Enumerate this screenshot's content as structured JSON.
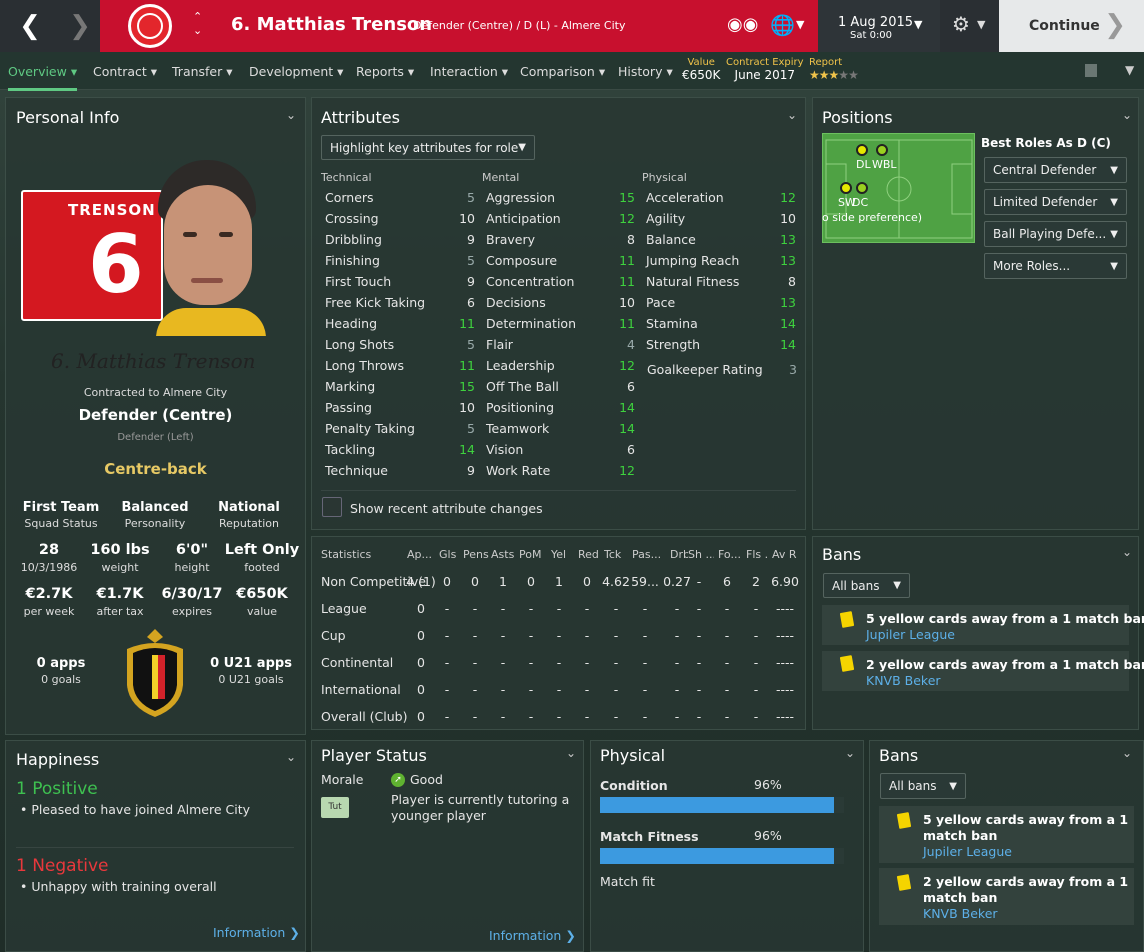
{
  "header": {
    "player_title": "6. Matthias Trenson",
    "player_sub": "Defender (Centre) / D (L) - Almere City",
    "date": "1 Aug 2015",
    "day": "Sat 0:00",
    "continue": "Continue",
    "club": "ALMERE CITY"
  },
  "nav": {
    "items": [
      "Overview",
      "Contract",
      "Transfer",
      "Development",
      "Reports",
      "Interaction",
      "Comparison",
      "History"
    ],
    "value_label": "Value",
    "value": "€650K",
    "expiry_label": "Contract Expiry",
    "expiry": "June 2017",
    "report_label": "Report",
    "report_stars": 3,
    "report_max": 5
  },
  "personal": {
    "title": "Personal Info",
    "shirt_name": "TRENSON",
    "shirt_number": "6",
    "signature": "6. Matthias Trenson",
    "contracted": "Contracted to Almere City",
    "position": "Defender (Centre)",
    "position2": "Defender (Left)",
    "role": "Centre-back",
    "stats": [
      [
        "First Team",
        "Squad Status"
      ],
      [
        "Balanced",
        "Personality"
      ],
      [
        "National",
        "Reputation"
      ],
      [
        "28",
        "10/3/1986"
      ],
      [
        "160 lbs",
        "weight"
      ],
      [
        "6'0\"",
        "height"
      ],
      [
        "Left Only",
        "footed"
      ],
      [
        "€2.7K",
        "per week"
      ],
      [
        "€1.7K",
        "after tax"
      ],
      [
        "6/30/17",
        "expires"
      ],
      [
        "€650K",
        "value"
      ],
      [
        "0 apps",
        "0 goals"
      ],
      [
        "0 U21 apps",
        "0 U21 goals"
      ]
    ]
  },
  "attributes": {
    "title": "Attributes",
    "highlight": "Highlight key attributes for role",
    "show_changes": "Show recent attribute changes",
    "technical_label": "Technical",
    "mental_label": "Mental",
    "physical_label": "Physical",
    "technical": [
      [
        "Corners",
        "5"
      ],
      [
        "Crossing",
        "10"
      ],
      [
        "Dribbling",
        "9"
      ],
      [
        "Finishing",
        "5"
      ],
      [
        "First Touch",
        "9"
      ],
      [
        "Free Kick Taking",
        "6"
      ],
      [
        "Heading",
        "11"
      ],
      [
        "Long Shots",
        "5"
      ],
      [
        "Long Throws",
        "11"
      ],
      [
        "Marking",
        "15"
      ],
      [
        "Passing",
        "10"
      ],
      [
        "Penalty Taking",
        "5"
      ],
      [
        "Tackling",
        "14"
      ],
      [
        "Technique",
        "9"
      ]
    ],
    "mental": [
      [
        "Aggression",
        "15"
      ],
      [
        "Anticipation",
        "12"
      ],
      [
        "Bravery",
        "8"
      ],
      [
        "Composure",
        "11"
      ],
      [
        "Concentration",
        "11"
      ],
      [
        "Decisions",
        "10"
      ],
      [
        "Determination",
        "11"
      ],
      [
        "Flair",
        "4"
      ],
      [
        "Leadership",
        "12"
      ],
      [
        "Off The Ball",
        "6"
      ],
      [
        "Positioning",
        "14"
      ],
      [
        "Teamwork",
        "14"
      ],
      [
        "Vision",
        "6"
      ],
      [
        "Work Rate",
        "12"
      ]
    ],
    "physical": [
      [
        "Acceleration",
        "12"
      ],
      [
        "Agility",
        "10"
      ],
      [
        "Balance",
        "13"
      ],
      [
        "Jumping Reach",
        "13"
      ],
      [
        "Natural Fitness",
        "8"
      ],
      [
        "Pace",
        "13"
      ],
      [
        "Stamina",
        "14"
      ],
      [
        "Strength",
        "14"
      ]
    ],
    "gk_label": "Goalkeeper Rating",
    "gk_value": "3"
  },
  "positions": {
    "title": "Positions",
    "best_roles": "Best Roles As D (C)",
    "labels": [
      "DL",
      "WBL",
      "SW",
      "DC"
    ],
    "pref_note": "o side preference)",
    "roles": [
      "Central Defender",
      "Limited Defender",
      "Ball Playing Defe...",
      "More Roles..."
    ]
  },
  "statistics": {
    "headers": [
      "Statistics",
      "Ap...",
      "Gls",
      "Pens",
      "Asts",
      "PoM",
      "Yel",
      "Red",
      "Tck",
      "Pas...",
      "Drb",
      "Sh ...",
      "Fo...",
      "Fls ...",
      "Av R"
    ],
    "rows": [
      [
        "Non Competitive",
        "4 (1)",
        "0",
        "0",
        "1",
        "0",
        "1",
        "0",
        "4.62",
        "59...",
        "0.27",
        "-",
        "6",
        "2",
        "6.90"
      ],
      [
        "League",
        "0",
        "-",
        "-",
        "-",
        "-",
        "-",
        "-",
        "-",
        "-",
        "-",
        "-",
        "-",
        "-",
        "----"
      ],
      [
        "Cup",
        "0",
        "-",
        "-",
        "-",
        "-",
        "-",
        "-",
        "-",
        "-",
        "-",
        "-",
        "-",
        "-",
        "----"
      ],
      [
        "Continental",
        "0",
        "-",
        "-",
        "-",
        "-",
        "-",
        "-",
        "-",
        "-",
        "-",
        "-",
        "-",
        "-",
        "----"
      ],
      [
        "International",
        "0",
        "-",
        "-",
        "-",
        "-",
        "-",
        "-",
        "-",
        "-",
        "-",
        "-",
        "-",
        "-",
        "----"
      ],
      [
        "Overall (Club)",
        "0",
        "-",
        "-",
        "-",
        "-",
        "-",
        "-",
        "-",
        "-",
        "-",
        "-",
        "-",
        "-",
        "----"
      ]
    ]
  },
  "bans": {
    "title": "Bans",
    "filter": "All bans",
    "items": [
      [
        "5 yellow cards away from a 1 match ban",
        "Jupiler League"
      ],
      [
        "2 yellow cards away from a 1 match ban",
        "KNVB Beker"
      ]
    ]
  },
  "bans2": {
    "title": "Bans",
    "filter": "All bans",
    "items": [
      [
        "5 yellow cards away from a 1",
        "match ban",
        "Jupiler League"
      ],
      [
        "2 yellow cards away from a 1",
        "match ban",
        "KNVB Beker"
      ]
    ]
  },
  "happiness": {
    "title": "Happiness",
    "positive": "1 Positive",
    "positive_item": "Pleased to have joined Almere City",
    "negative": "1 Negative",
    "negative_item": "Unhappy with training overall",
    "info": "Information"
  },
  "status": {
    "title": "Player Status",
    "morale_label": "Morale",
    "morale": "Good",
    "tut": "Tut",
    "tut_text1": "Player is currently tutoring a",
    "tut_text2": "younger player",
    "info": "Information"
  },
  "physical": {
    "title": "Physical",
    "condition_label": "Condition",
    "condition": "96%",
    "condition_pct": 0.96,
    "fitness_label": "Match Fitness",
    "fitness": "96%",
    "fitness_pct": 0.96,
    "match_fit": "Match fit"
  },
  "colors": {
    "red": "#c8102e",
    "green": "#3ed13e",
    "blue": "#3c9ae0",
    "gold": "#f0c34a"
  }
}
